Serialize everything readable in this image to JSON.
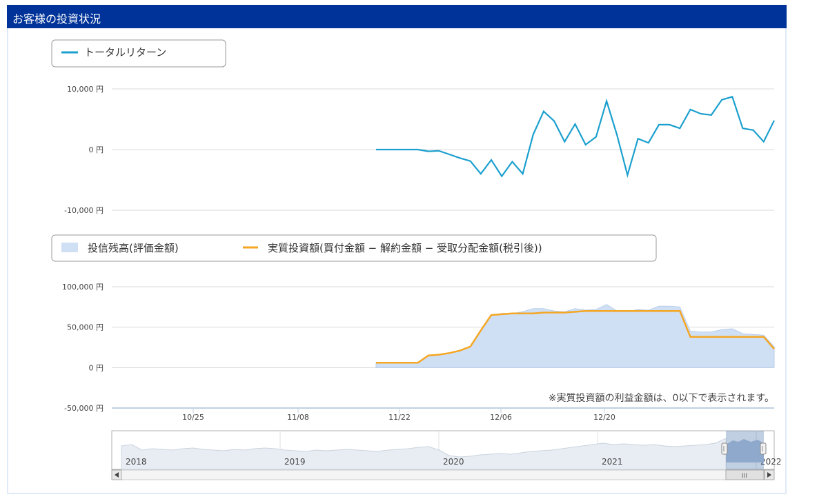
{
  "header": {
    "title": "お客様の投資状況"
  },
  "note": "※実質投資額の利益金額は、0以下で表示されます。",
  "colors": {
    "header": "#003399",
    "return_line": "#1a9fce",
    "balance_area": "#cfe0f5",
    "invested_line": "#f5a623"
  },
  "chart_data": [
    {
      "type": "line",
      "legend": [
        "トータルリターン"
      ],
      "yticks": [
        "10,000 円",
        "0 円",
        "-10,000 円"
      ],
      "ylim": [
        -10000,
        10000
      ],
      "series": [
        {
          "name": "トータルリターン",
          "values": [
            0,
            0,
            0,
            0,
            0,
            -300,
            -200,
            -800,
            -1400,
            -1900,
            -4000,
            -1700,
            -4400,
            -2000,
            -4000,
            2500,
            6300,
            4700,
            1300,
            4200,
            800,
            2100,
            8000,
            2400,
            -4200,
            1800,
            1100,
            4100,
            4100,
            3500,
            6600,
            5900,
            5700,
            8200,
            8700,
            3500,
            3200,
            1300,
            4800
          ]
        }
      ]
    },
    {
      "type": "area",
      "legend": [
        "投信残高(評価金額)",
        "実質投資額(買付金額 − 解約金額 − 受取分配金額(税引後))"
      ],
      "yticks": [
        "100,000 円",
        "50,000 円",
        "0 円",
        "-50,000 円"
      ],
      "ylim": [
        -50000,
        100000
      ],
      "x_labels": [
        "10/25",
        "11/08",
        "11/22",
        "12/06",
        "12/20"
      ],
      "series": [
        {
          "name": "投信残高(評価金額)",
          "values": [
            6000,
            6000,
            6000,
            6000,
            6000,
            15000,
            16000,
            18000,
            21000,
            26000,
            47000,
            65000,
            67000,
            67000,
            69000,
            73000,
            73000,
            70000,
            69000,
            73000,
            71000,
            72000,
            78000,
            70000,
            69000,
            72000,
            71000,
            76000,
            76000,
            75000,
            45000,
            44000,
            44000,
            47000,
            48000,
            42000,
            41000,
            40000,
            26000
          ]
        },
        {
          "name": "実質投資額(買付金額 − 解約金額 − 受取分配金額(税引後))",
          "values": [
            6000,
            6000,
            6000,
            6000,
            6000,
            15000,
            16000,
            18000,
            21000,
            26000,
            46000,
            65000,
            66000,
            67000,
            67000,
            67000,
            68000,
            68000,
            68000,
            69000,
            70000,
            70000,
            70000,
            70000,
            70000,
            70000,
            70000,
            70000,
            70000,
            70000,
            38000,
            38000,
            38000,
            38000,
            38000,
            38000,
            38000,
            38000,
            23000
          ]
        }
      ]
    }
  ],
  "navigator": {
    "years": [
      "2018",
      "2019",
      "2020",
      "2021",
      "2022"
    ],
    "scrollbar_grip": "III"
  }
}
